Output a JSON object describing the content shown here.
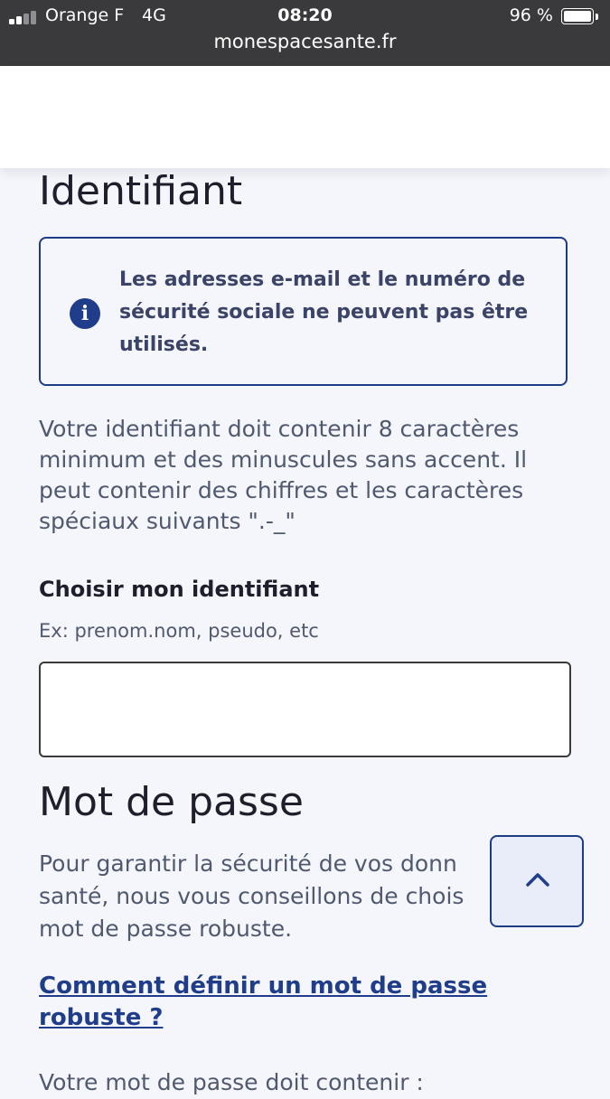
{
  "status_bar": {
    "carrier": "Orange F",
    "network": "4G",
    "time": "08:20",
    "battery": "96 %",
    "battery_level": 0.96,
    "url": "monespacesante.fr"
  },
  "identifiant": {
    "heading": "Identifiant",
    "info_text": "Les adresses e-mail et le numéro de sécurité sociale ne peuvent pas être utilisés.",
    "description": "Votre identifiant doit contenir 8 caractères minimum et des minuscules sans accent. Il peut contenir des chiffres et les caractères spéciaux suivants \".-_\"",
    "field_label": "Choisir mon identifiant",
    "field_hint": "Ex: prenom.nom, pseudo, etc",
    "field_value": ""
  },
  "password": {
    "heading": "Mot de passe",
    "intro": "Pour garantir la sécurité de vos donn… santé, nous vous conseillons de chois… mot de passe robuste.",
    "intro_lines": [
      "Pour garantir la sécurité de vos donn",
      "santé, nous vous conseillons de chois",
      "mot de passe robuste."
    ],
    "link": "Comment définir un mot de passe robuste ?",
    "partial_text": "Votre mot de passe doit contenir :"
  },
  "icons": {
    "info": "info-icon",
    "back_to_top": "chevron-up-icon"
  },
  "colors": {
    "accent": "#1f3d8a",
    "page_bg": "#f5f6fb",
    "status_bar": "#3a3a3c"
  }
}
